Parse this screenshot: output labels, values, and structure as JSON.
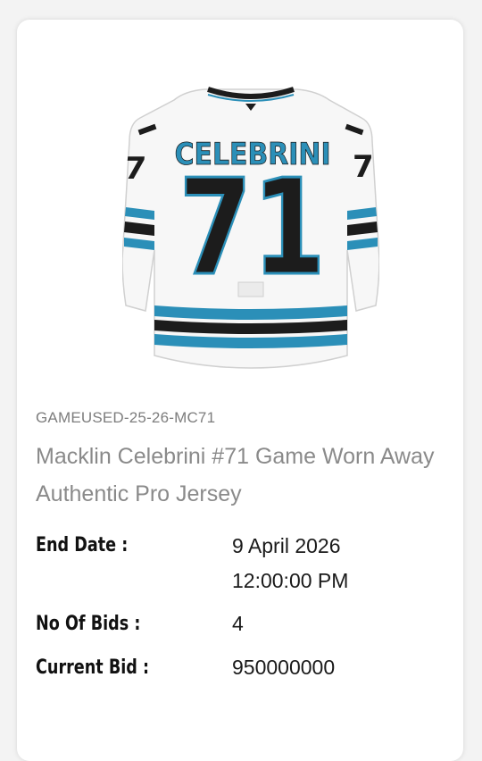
{
  "item": {
    "sku": "GAMEUSED-25-26-MC71",
    "title": "Macklin Celebrini #71 Game Worn Away Authentic Pro Jersey",
    "jersey_nameplate": "CELEBRINI",
    "jersey_number": "71",
    "image_icon": "jersey-photo"
  },
  "details": {
    "end_date_label": "End Date :",
    "end_date_value": "9 April 2026",
    "end_time_value": "12:00:00 PM",
    "bids_label": "No Of Bids :",
    "bids_value": "4",
    "current_bid_label": "Current Bid :",
    "current_bid_value": "950000000"
  },
  "colors": {
    "teal": "#2b8fb8",
    "black": "#1c1c1c",
    "jersey_white": "#f7f7f7"
  }
}
